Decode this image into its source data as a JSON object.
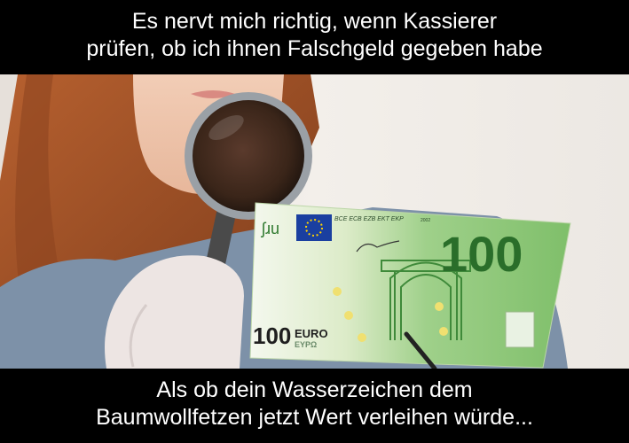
{
  "caption_top": {
    "line1": "Es nervt mich richtig, wenn Kassierer",
    "line2": "prüfen, ob ich ihnen Falschgeld gegeben habe"
  },
  "caption_bottom": {
    "line1": "Als ob dein Wasserzeichen dem",
    "line2": "Baumwollfetzen jetzt Wert verleihen würde..."
  },
  "banknote": {
    "value": "100",
    "value_small": "100",
    "currency": "EURO",
    "currency_greek": "EYPΩ",
    "issuer_codes": "BCE ECB EZB EKT EKP",
    "year": "2002",
    "signature_initials": "ʃɹu"
  },
  "colors": {
    "caption_bg": "#000000",
    "caption_text": "#ffffff",
    "note_green": "#7fbf6a",
    "eu_blue": "#1a3fa0",
    "eu_star": "#ffd200",
    "hair": "#a8552a",
    "wall": "#f1ede8",
    "sweater": "#7d91a8"
  }
}
